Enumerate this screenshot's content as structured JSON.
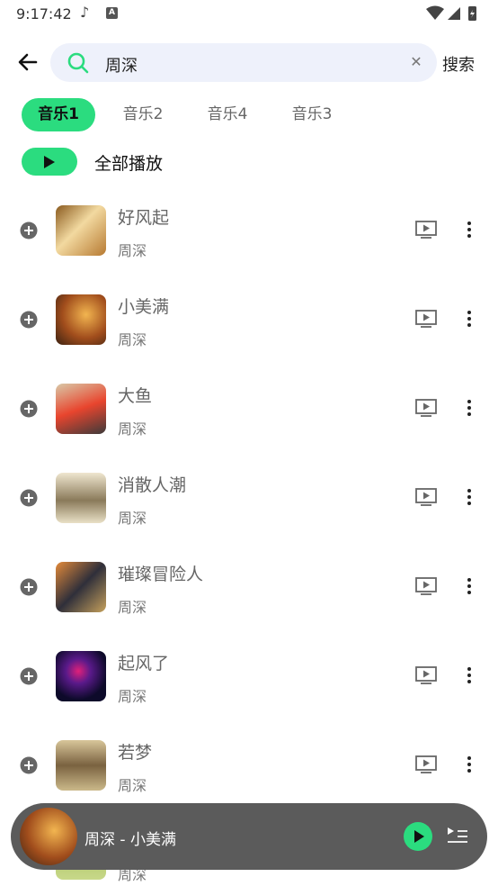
{
  "status_bar": {
    "time": "9:17:42",
    "icons": [
      "music-note-icon",
      "a-badge-icon",
      "wifi-icon",
      "signal-icon",
      "battery-icon"
    ]
  },
  "search": {
    "query": "周深",
    "submit_label": "搜索",
    "icons": [
      "back-arrow-icon",
      "search-icon",
      "clear-icon"
    ]
  },
  "tabs": [
    {
      "label": "音乐1",
      "active": true
    },
    {
      "label": "音乐2",
      "active": false
    },
    {
      "label": "音乐4",
      "active": false
    },
    {
      "label": "音乐3",
      "active": false
    }
  ],
  "play_all": {
    "label": "全部播放"
  },
  "songs": [
    {
      "title": "好风起",
      "artist": "周深"
    },
    {
      "title": "小美满",
      "artist": "周深"
    },
    {
      "title": "大鱼",
      "artist": "周深"
    },
    {
      "title": "消散人潮",
      "artist": "周深"
    },
    {
      "title": "璀璨冒险人",
      "artist": "周深"
    },
    {
      "title": "起风了",
      "artist": "周深"
    },
    {
      "title": "若梦",
      "artist": "周深"
    },
    {
      "title": "",
      "artist": "周深"
    }
  ],
  "mini_player": {
    "now_playing": "周深 - 小美满"
  },
  "colors": {
    "accent": "#2bdc7f",
    "search_bg": "#eef1fb",
    "player_bg": "#5b5b5b"
  }
}
